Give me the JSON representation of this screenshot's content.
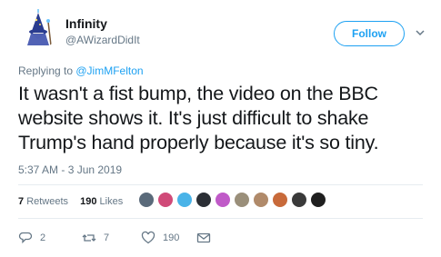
{
  "user": {
    "display_name": "Infinity",
    "handle": "@AWizardDidIt"
  },
  "follow_label": "Follow",
  "reply_prefix": "Replying to ",
  "reply_to": "@JimMFelton",
  "tweet_text": "It wasn't a fist bump, the video on the BBC website shows it. It's just difficult to shake Trump's hand properly because it's so tiny.",
  "timestamp": "5:37 AM - 3 Jun 2019",
  "stats": {
    "retweets_count": "7",
    "retweets_label": "Retweets",
    "likes_count": "190",
    "likes_label": "Likes"
  },
  "actions": {
    "reply_count": "2",
    "retweet_count": "7",
    "like_count": "190"
  },
  "colors": {
    "accent": "#1da1f2",
    "secondary_text": "#657786",
    "divider": "#e6ecf0"
  },
  "likers": [
    {
      "name": "liker-avatar-1",
      "color": "#5a6a7a"
    },
    {
      "name": "liker-avatar-2",
      "color": "#d04a78"
    },
    {
      "name": "liker-avatar-3",
      "color": "#49b3e8"
    },
    {
      "name": "liker-avatar-4",
      "color": "#2b2f35"
    },
    {
      "name": "liker-avatar-5",
      "color": "#c05ac8"
    },
    {
      "name": "liker-avatar-6",
      "color": "#9a8f7a"
    },
    {
      "name": "liker-avatar-7",
      "color": "#b08a6a"
    },
    {
      "name": "liker-avatar-8",
      "color": "#c86a3a"
    },
    {
      "name": "liker-avatar-9",
      "color": "#3a3a3a"
    },
    {
      "name": "liker-avatar-10",
      "color": "#1f1f1f"
    }
  ]
}
